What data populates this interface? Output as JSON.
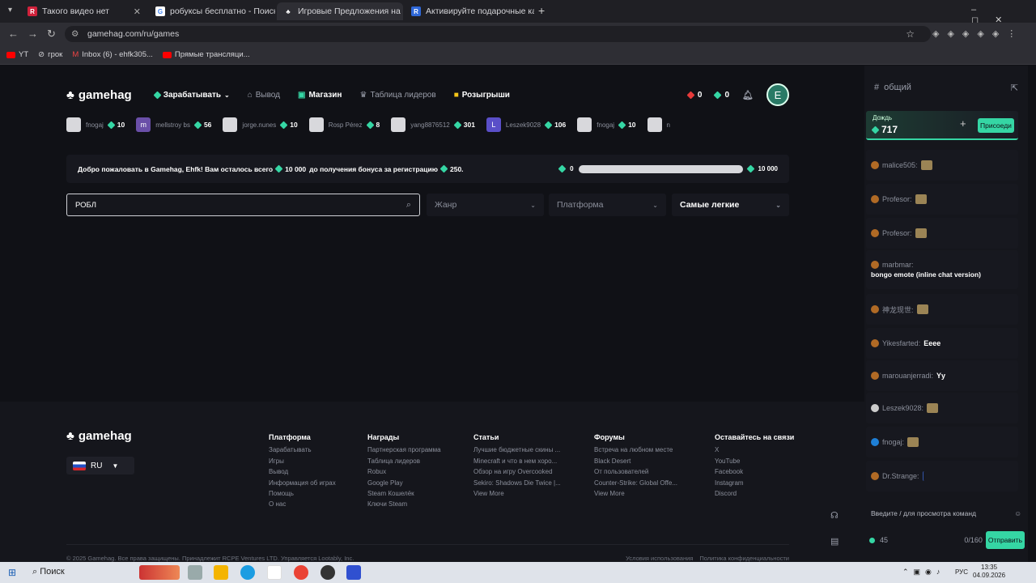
{
  "browser": {
    "tabs": [
      {
        "label": "Такого видео нет",
        "color": "#d0213b",
        "icon": "R"
      },
      {
        "label": "робуксы бесплатно - Поиск в",
        "color": "#4285f4",
        "icon": "G"
      },
      {
        "label": "Игровые Предложения на Ga",
        "color": "#ffffff",
        "icon": "gamehag-icon"
      },
      {
        "label": "Активируйте подарочные кар",
        "color": "#2f68d8",
        "icon": "R"
      }
    ],
    "url": "gamehag.com/ru/games",
    "bookmarks": [
      "YT",
      "грок",
      "Inbox (6) - ehfk305...",
      "Прямые трансляци..."
    ]
  },
  "site": {
    "logo": "gamehag",
    "nav": {
      "earn": "Зарабатывать",
      "withdraw": "Вывод",
      "shop": "Магазин",
      "leaderboard": "Таблица лидеров",
      "giveaways": "Розыгрыши",
      "red_count": "0",
      "gem_count": "0",
      "avatar": "E"
    },
    "feed": [
      {
        "user": "fnogaj",
        "value": "10",
        "avatar": ""
      },
      {
        "user": "mellstroy bs",
        "value": "56",
        "avatar": "m"
      },
      {
        "user": "jorge.nunes",
        "value": "10",
        "avatar": ""
      },
      {
        "user": "Rosp Pérez",
        "value": "8",
        "avatar": ""
      },
      {
        "user": "yang8876512",
        "value": "301",
        "avatar": ""
      },
      {
        "user": "Leszek9028",
        "value": "106",
        "avatar": "L"
      },
      {
        "user": "fnogaj",
        "value": "10",
        "avatar": ""
      },
      {
        "user": "n",
        "value": "",
        "avatar": ""
      }
    ],
    "welcome": {
      "text_a": "Добро пожаловать в Gamehag, Ehfk! Вам осталось всего",
      "amount": "10 000",
      "text_b": "до получения бонуса за регистрацию",
      "bonus": "250.",
      "progress_start": "0",
      "progress_end": "10 000",
      "progress_fraction": 0
    },
    "search_value": "РОБЛ",
    "filters": {
      "genre": "Жанр",
      "platform": "Платформа",
      "sort": "Самые легкие"
    },
    "footer": {
      "lang": "RU",
      "cols": [
        {
          "title": "Платформа",
          "items": [
            "Зарабатывать",
            "Игры",
            "Вывод",
            "Информация об играх",
            "Помощь",
            "О нас"
          ]
        },
        {
          "title": "Награды",
          "items": [
            "Партнерская программа",
            "Таблица лидеров",
            "Robux",
            "Google Play",
            "Steam Кошелёк",
            "Ключи Steam"
          ]
        },
        {
          "title": "Статьи",
          "items": [
            "Лучшие бюджетные скины ...",
            "Minecraft и что в нем хоро...",
            "Обзор на игру Overcooked",
            "Sekiro: Shadows Die Twice |...",
            "View More"
          ]
        },
        {
          "title": "Форумы",
          "items": [
            "Встреча на любном месте",
            "Black Desert",
            "От пользователей",
            "Counter-Strike: Global Offe...",
            "View More"
          ]
        },
        {
          "title": "Оставайтесь на связи",
          "items": [
            "X",
            "YouTube",
            "Facebook",
            "Instagram",
            "Discord"
          ]
        }
      ],
      "copyright": "© 2025 Gamehag. Все права защищены. Принадлежит RCPE Ventures LTD. Управляется Lootably, Inc.",
      "terms": "Условия использования",
      "privacy": "Политика конфиденциальности"
    }
  },
  "chat": {
    "channel": "общий",
    "rain_label": "Дождь",
    "rain_amount": "717",
    "join": "Присоеди",
    "messages": [
      {
        "user": "malice505:",
        "text": ""
      },
      {
        "user": "Profesor:",
        "text": ""
      },
      {
        "user": "Profesor:",
        "text": ""
      },
      {
        "user": "marbmar:",
        "text": "bongo emote (inline chat version)"
      },
      {
        "user": "神龙现世:",
        "text": ""
      },
      {
        "user": "Yikesfarted:",
        "text": "Eeee"
      },
      {
        "user": "marouanjerradi:",
        "text": "Yy"
      },
      {
        "user": "Leszek9028:",
        "text": ""
      },
      {
        "user": "fnogaj:",
        "text": ""
      },
      {
        "user": "Dr.Strange:",
        "text": ""
      }
    ],
    "input_placeholder": "Введите / для просмотра команд",
    "online": "45",
    "counter": "0/160",
    "send": "Отправить"
  },
  "taskbar": {
    "search": "Поиск",
    "lang": "РУС",
    "time": "13:35",
    "date": "04.09.2026"
  }
}
